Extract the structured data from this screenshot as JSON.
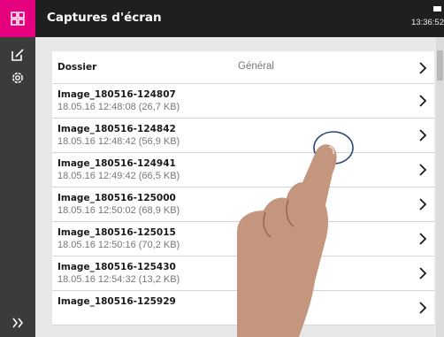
{
  "app": {
    "icons": {
      "apps": "grid-icon",
      "edit": "edit-icon",
      "settings": "gear-icon",
      "expand": "double-chevron-right-icon",
      "battery": "battery-icon",
      "row_arrow": "chevron-right-icon"
    },
    "colors": {
      "accent": "#e5007e",
      "header": "#1f1f1f",
      "sidebar": "#3b3b3b"
    }
  },
  "header": {
    "title": "Captures d'écran",
    "clock": "13:36:52"
  },
  "folder": {
    "label": "Dossier",
    "value": "Général"
  },
  "items": [
    {
      "name": "Image_180516-124807",
      "meta": "18.05.16 12:48:08  (26,7 KB)"
    },
    {
      "name": "Image_180516-124842",
      "meta": "18.05.16 12:48:42  (56,9 KB)"
    },
    {
      "name": "Image_180516-124941",
      "meta": "18.05.16 12:49:42  (66,5 KB)"
    },
    {
      "name": "Image_180516-125000",
      "meta": "18.05.16 12:50:02  (68,9 KB)"
    },
    {
      "name": "Image_180516-125015",
      "meta": "18.05.16 12:50:16  (70,2 KB)"
    },
    {
      "name": "Image_180516-125430",
      "meta": "18.05.16 12:54:32  (13,2 KB)"
    },
    {
      "name": "Image_180516-125929",
      "meta": ""
    }
  ]
}
